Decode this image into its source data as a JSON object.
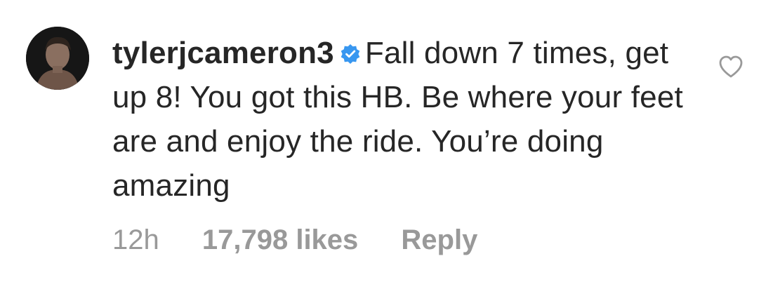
{
  "comment": {
    "avatar_icon": "user-avatar-photo",
    "username": "tylerjcameron3",
    "verified_icon": "verified-badge-icon",
    "verified_color": "#3897f0",
    "text": "Fall down 7 times, get up 8! You got this HB. Be where your feet are and enjoy the ride. You’re doing amazing",
    "timestamp": "12h",
    "likes": "17,798 likes",
    "reply_label": "Reply",
    "like_icon": "heart-outline-icon"
  }
}
